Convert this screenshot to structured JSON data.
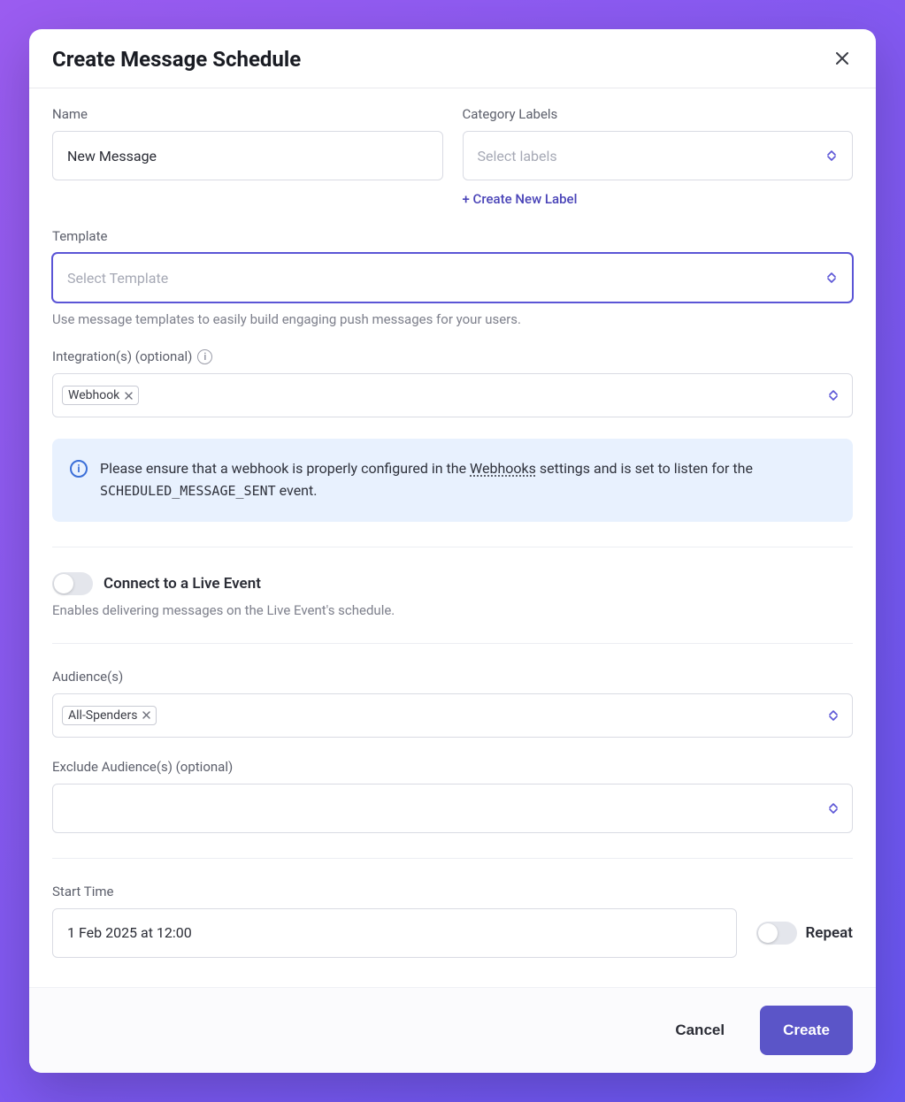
{
  "modal": {
    "title": "Create Message Schedule"
  },
  "name": {
    "label": "Name",
    "value": "New Message"
  },
  "category": {
    "label": "Category Labels",
    "placeholder": "Select labels",
    "create_link": "+ Create New Label"
  },
  "template": {
    "label": "Template",
    "placeholder": "Select Template",
    "help": "Use message templates to easily build engaging push messages for your users."
  },
  "integrations": {
    "label": "Integration(s) (optional)",
    "chips": [
      "Webhook"
    ]
  },
  "alert": {
    "pre": "Please ensure that a webhook is properly configured in the ",
    "link": "Webhooks",
    "mid": " settings and is set to listen for the ",
    "code": "SCHEDULED_MESSAGE_SENT",
    "post": " event."
  },
  "live_event": {
    "label": "Connect to a Live Event",
    "help": "Enables delivering messages on the Live Event's schedule."
  },
  "audiences": {
    "label": "Audience(s)",
    "chips": [
      "All-Spenders"
    ]
  },
  "exclude": {
    "label": "Exclude Audience(s) (optional)"
  },
  "start": {
    "label": "Start Time",
    "value": "1 Feb 2025 at 12:00",
    "repeat_label": "Repeat"
  },
  "footer": {
    "cancel": "Cancel",
    "create": "Create"
  }
}
